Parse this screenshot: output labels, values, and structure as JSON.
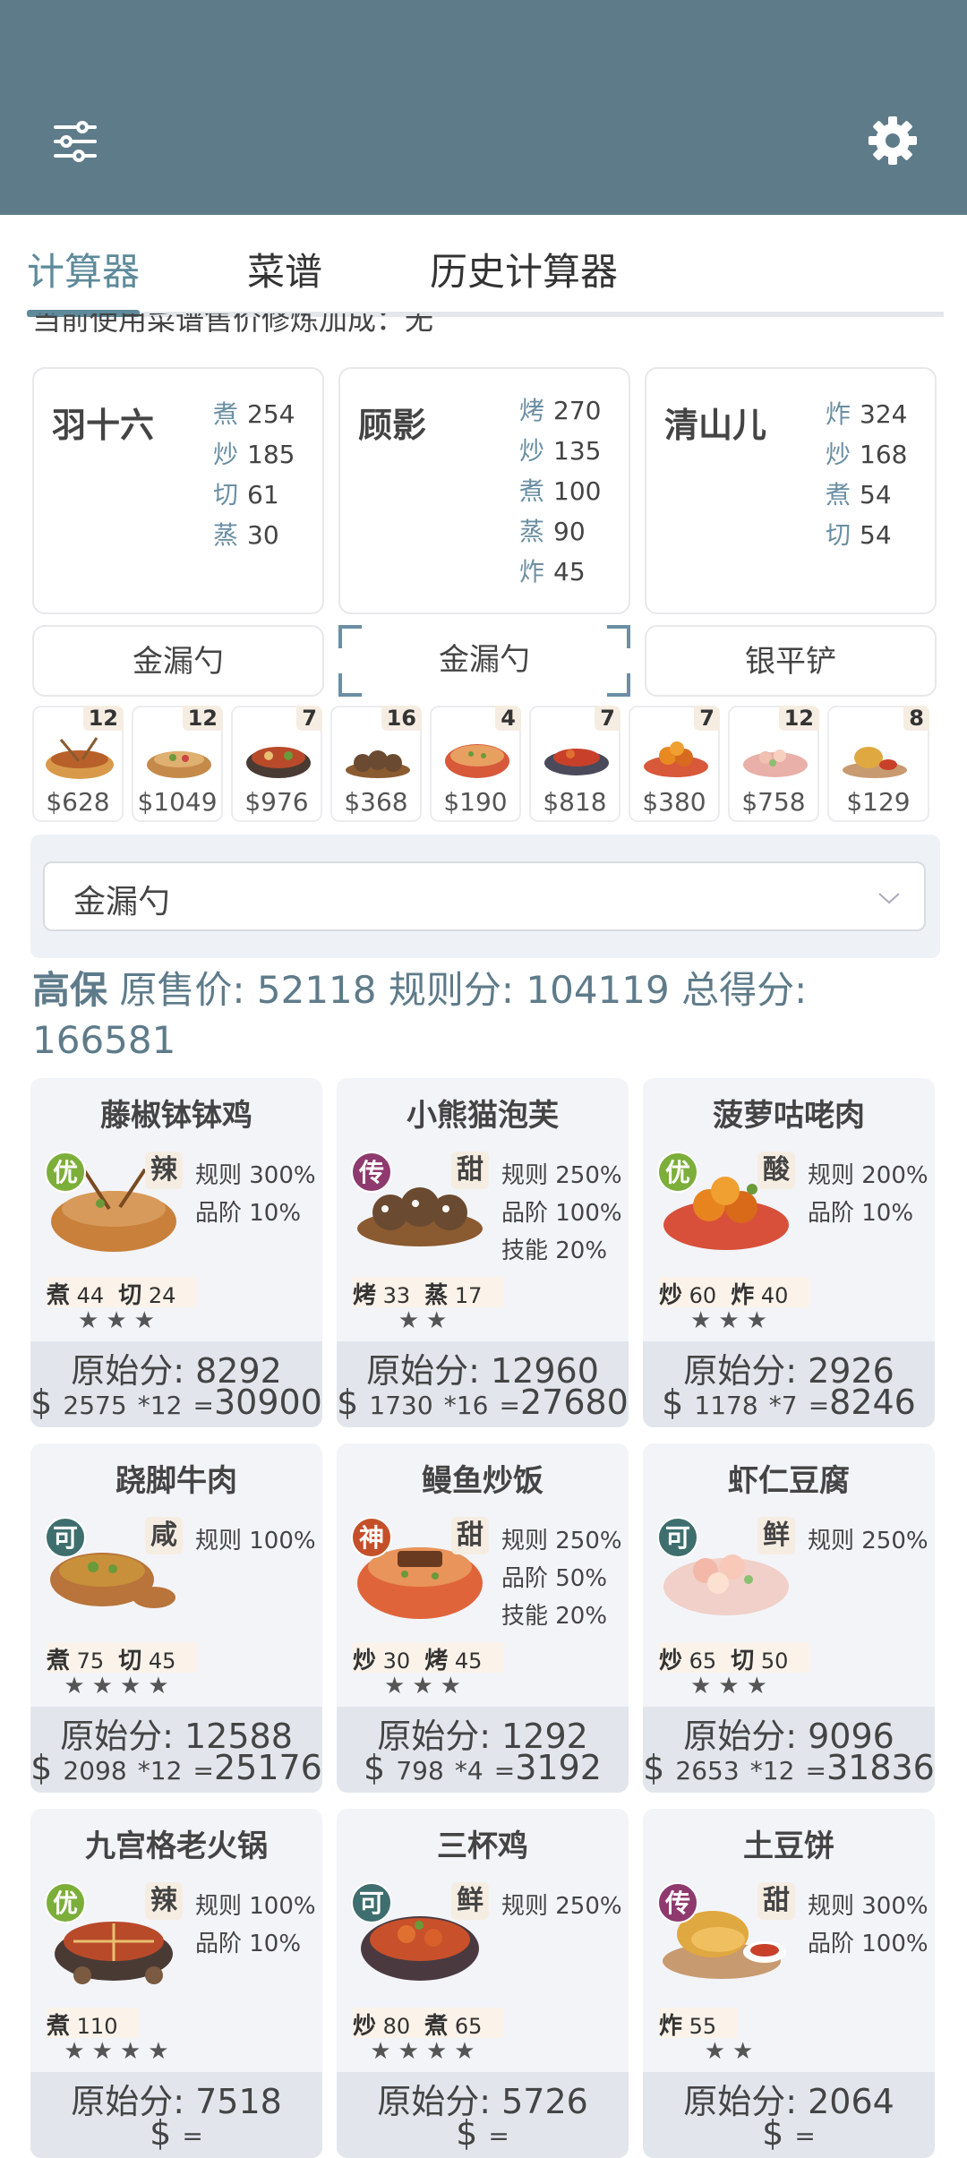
{
  "topbar": {
    "menu_icon": "sliders-icon",
    "settings_icon": "gear-icon",
    "color": "#5e7b8a"
  },
  "tabs": [
    {
      "label": "计算器",
      "active": true
    },
    {
      "label": "菜谱",
      "active": false
    },
    {
      "label": "历史计算器",
      "active": false
    }
  ],
  "cutoff_text": "当前使用菜谱售价修炼加成：无",
  "chefs": [
    {
      "name": "羽十六",
      "skills": [
        {
          "k": "煮",
          "v": "254"
        },
        {
          "k": "炒",
          "v": "185"
        },
        {
          "k": "切",
          "v": "61"
        },
        {
          "k": "蒸",
          "v": "30"
        }
      ]
    },
    {
      "name": "顾影",
      "skills": [
        {
          "k": "烤",
          "v": "270"
        },
        {
          "k": "炒",
          "v": "135"
        },
        {
          "k": "煮",
          "v": "100"
        },
        {
          "k": "蒸",
          "v": "90"
        },
        {
          "k": "炸",
          "v": "45"
        }
      ]
    },
    {
      "name": "清山儿",
      "skills": [
        {
          "k": "炸",
          "v": "324"
        },
        {
          "k": "炒",
          "v": "168"
        },
        {
          "k": "煮",
          "v": "54"
        },
        {
          "k": "切",
          "v": "54"
        }
      ]
    }
  ],
  "tools": [
    "金漏勺",
    "金漏勺",
    "银平铲"
  ],
  "dishes_small": [
    {
      "count": "12",
      "price": "$628"
    },
    {
      "count": "12",
      "price": "$1049"
    },
    {
      "count": "7",
      "price": "$976"
    },
    {
      "count": "16",
      "price": "$368"
    },
    {
      "count": "4",
      "price": "$190"
    },
    {
      "count": "7",
      "price": "$818"
    },
    {
      "count": "7",
      "price": "$380"
    },
    {
      "count": "12",
      "price": "$758"
    },
    {
      "count": "8",
      "price": "$129"
    }
  ],
  "select": {
    "value": "金漏勺"
  },
  "summary": {
    "tag": "高保",
    "label1": "原售价:",
    "v1": "52118",
    "label2": "规则分:",
    "v2": "104119",
    "label3": "总得分:",
    "v3": "166581"
  },
  "cards": [
    {
      "title": "藤椒钵钵鸡",
      "rarity": "优",
      "rarity_color": "#7cae3a",
      "flavor": "辣",
      "rules": [
        "规则 300%",
        "品阶 10%"
      ],
      "skills": [
        {
          "k": "煮",
          "v": "44"
        },
        {
          "k": "切",
          "v": "24"
        }
      ],
      "stars": "★★★",
      "orig": "原始分: 8292",
      "price": "2575",
      "mult": "*12",
      "total": "30900"
    },
    {
      "title": "小熊猫泡芙",
      "rarity": "传",
      "rarity_color": "#8e3a6e",
      "flavor": "甜",
      "rules": [
        "规则 250%",
        "品阶 100%",
        "技能 20%"
      ],
      "skills": [
        {
          "k": "烤",
          "v": "33"
        },
        {
          "k": "蒸",
          "v": "17"
        }
      ],
      "stars": "★★",
      "orig": "原始分: 12960",
      "price": "1730",
      "mult": "*16",
      "total": "27680"
    },
    {
      "title": "菠萝咕咾肉",
      "rarity": "优",
      "rarity_color": "#7cae3a",
      "flavor": "酸",
      "rules": [
        "规则 200%",
        "品阶 10%"
      ],
      "skills": [
        {
          "k": "炒",
          "v": "60"
        },
        {
          "k": "炸",
          "v": "40"
        }
      ],
      "stars": "★★★",
      "orig": "原始分: 2926",
      "price": "1178",
      "mult": "*7",
      "total": "8246"
    },
    {
      "title": "跷脚牛肉",
      "rarity": "可",
      "rarity_color": "#3e6e6e",
      "flavor": "咸",
      "rules": [
        "规则 100%"
      ],
      "skills": [
        {
          "k": "煮",
          "v": "75"
        },
        {
          "k": "切",
          "v": "45"
        }
      ],
      "stars": "★★★★",
      "orig": "原始分: 12588",
      "price": "2098",
      "mult": "*12",
      "total": "25176"
    },
    {
      "title": "鳗鱼炒饭",
      "rarity": "神",
      "rarity_color": "#c4502a",
      "flavor": "甜",
      "rules": [
        "规则 250%",
        "品阶 50%",
        "技能 20%"
      ],
      "skills": [
        {
          "k": "炒",
          "v": "30"
        },
        {
          "k": "烤",
          "v": "45"
        }
      ],
      "stars": "★★★",
      "orig": "原始分: 1292",
      "price": "798",
      "mult": "*4",
      "total": "3192"
    },
    {
      "title": "虾仁豆腐",
      "rarity": "可",
      "rarity_color": "#3e6e6e",
      "flavor": "鲜",
      "rules": [
        "规则 250%"
      ],
      "skills": [
        {
          "k": "炒",
          "v": "65"
        },
        {
          "k": "切",
          "v": "50"
        }
      ],
      "stars": "★★★",
      "orig": "原始分: 9096",
      "price": "2653",
      "mult": "*12",
      "total": "31836"
    },
    {
      "title": "九宫格老火锅",
      "rarity": "优",
      "rarity_color": "#7cae3a",
      "flavor": "辣",
      "rules": [
        "规则 100%",
        "品阶 10%"
      ],
      "skills": [
        {
          "k": "煮",
          "v": "110"
        }
      ],
      "stars": "★★★★",
      "orig": "原始分: 7518",
      "price": "",
      "mult": "",
      "total": ""
    },
    {
      "title": "三杯鸡",
      "rarity": "可",
      "rarity_color": "#3e6e6e",
      "flavor": "鲜",
      "rules": [
        "规则 250%"
      ],
      "skills": [
        {
          "k": "炒",
          "v": "80"
        },
        {
          "k": "煮",
          "v": "65"
        }
      ],
      "stars": "★★★★",
      "orig": "原始分: 5726",
      "price": "",
      "mult": "",
      "total": ""
    },
    {
      "title": "土豆饼",
      "rarity": "传",
      "rarity_color": "#8e3a6e",
      "flavor": "甜",
      "rules": [
        "规则 300%",
        "品阶 100%"
      ],
      "skills": [
        {
          "k": "炸",
          "v": "55"
        }
      ],
      "stars": "★★",
      "orig": "原始分: 2064",
      "price": "",
      "mult": "",
      "total": ""
    }
  ]
}
